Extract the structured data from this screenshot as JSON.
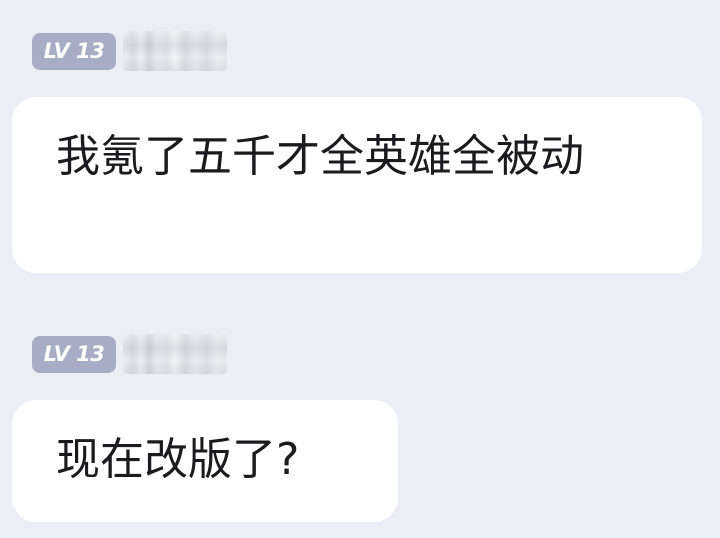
{
  "messages": [
    {
      "level_badge": "LV 13",
      "text": "我氪了五千才全英雄全被动"
    },
    {
      "level_badge": "LV 13",
      "text": "现在改版了?"
    }
  ]
}
